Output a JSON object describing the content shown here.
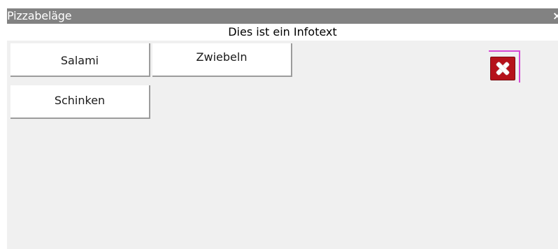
{
  "window": {
    "title": "Pizzabeläge",
    "close_glyph": "×"
  },
  "info": {
    "text": "Dies ist ein Infotext"
  },
  "toppings": [
    {
      "label": "Salami"
    },
    {
      "label": "Zwiebeln"
    },
    {
      "label": "Schinken"
    }
  ],
  "delete_button": {
    "icon": "delete-x-icon",
    "color": "#b5121b"
  },
  "colors": {
    "titlebar": "#828282",
    "panel": "#f0f0f0",
    "tile": "#ffffff",
    "accent_border": "#d54ad5"
  }
}
